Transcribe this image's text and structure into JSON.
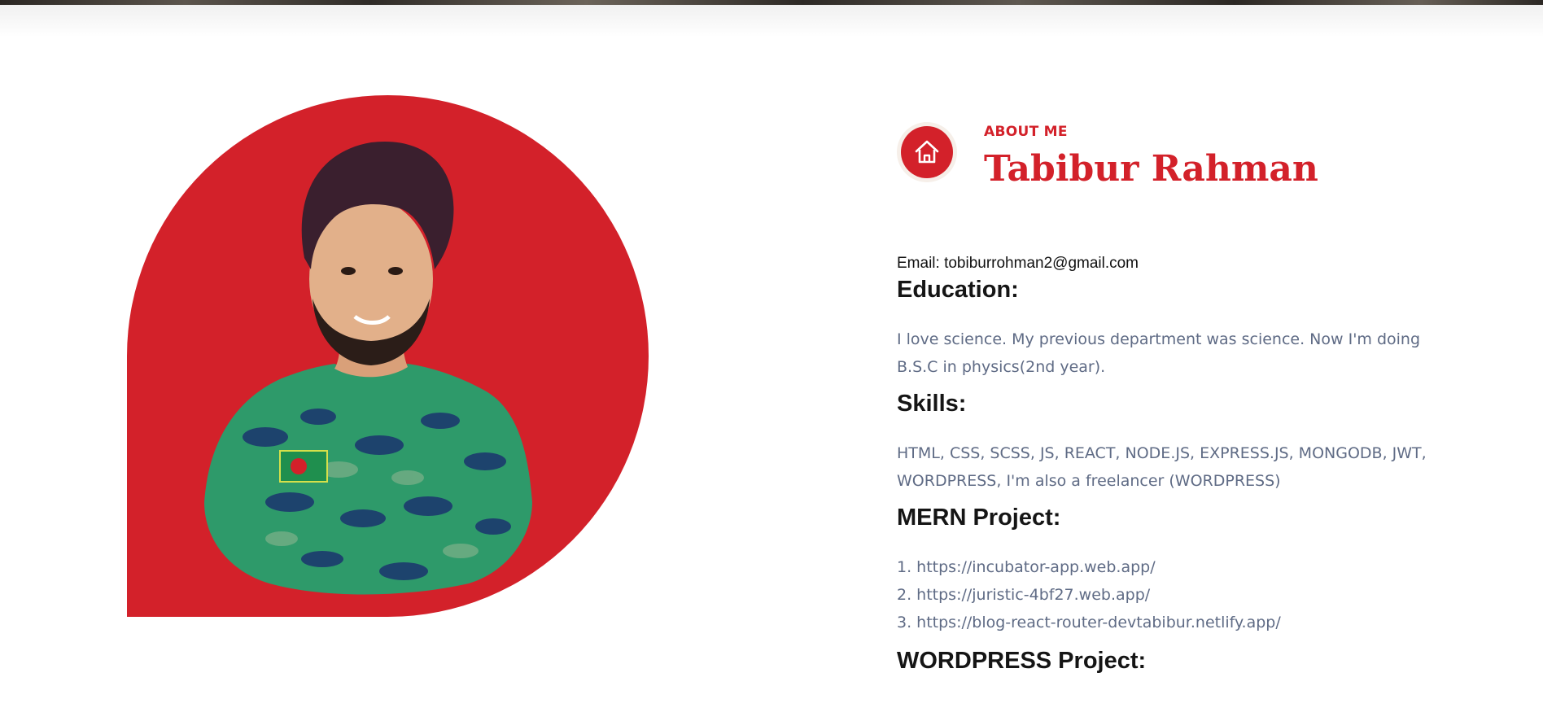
{
  "about": {
    "eyebrow": "ABOUT ME",
    "name": "Tabibur Rahman",
    "icon": "home-icon"
  },
  "profile": {
    "email": "Email: tobiburrohman2@gmail.com",
    "education_heading": "Education:",
    "education_text": "I love science. My previous department was science. Now I'm doing B.S.C in physics(2nd year).",
    "skills_heading": "Skills:",
    "skills_text": "HTML, CSS, SCSS, JS, REACT, NODE.JS, EXPRESS.JS, MONGODB, JWT, WORDPRESS, I'm also a freelancer (WORDPRESS)",
    "mern_heading": "MERN Project:",
    "mern_projects": [
      "1. https://incubator-app.web.app/",
      "2. https://juristic-4bf27.web.app/",
      "3. https://blog-react-router-devtabibur.netlify.app/"
    ],
    "wordpress_heading": "WORDPRESS Project:"
  },
  "colors": {
    "accent": "#d3212a",
    "body_text": "#5f6b85",
    "heading_text": "#151515",
    "icon_ring": "#f6efe9"
  }
}
